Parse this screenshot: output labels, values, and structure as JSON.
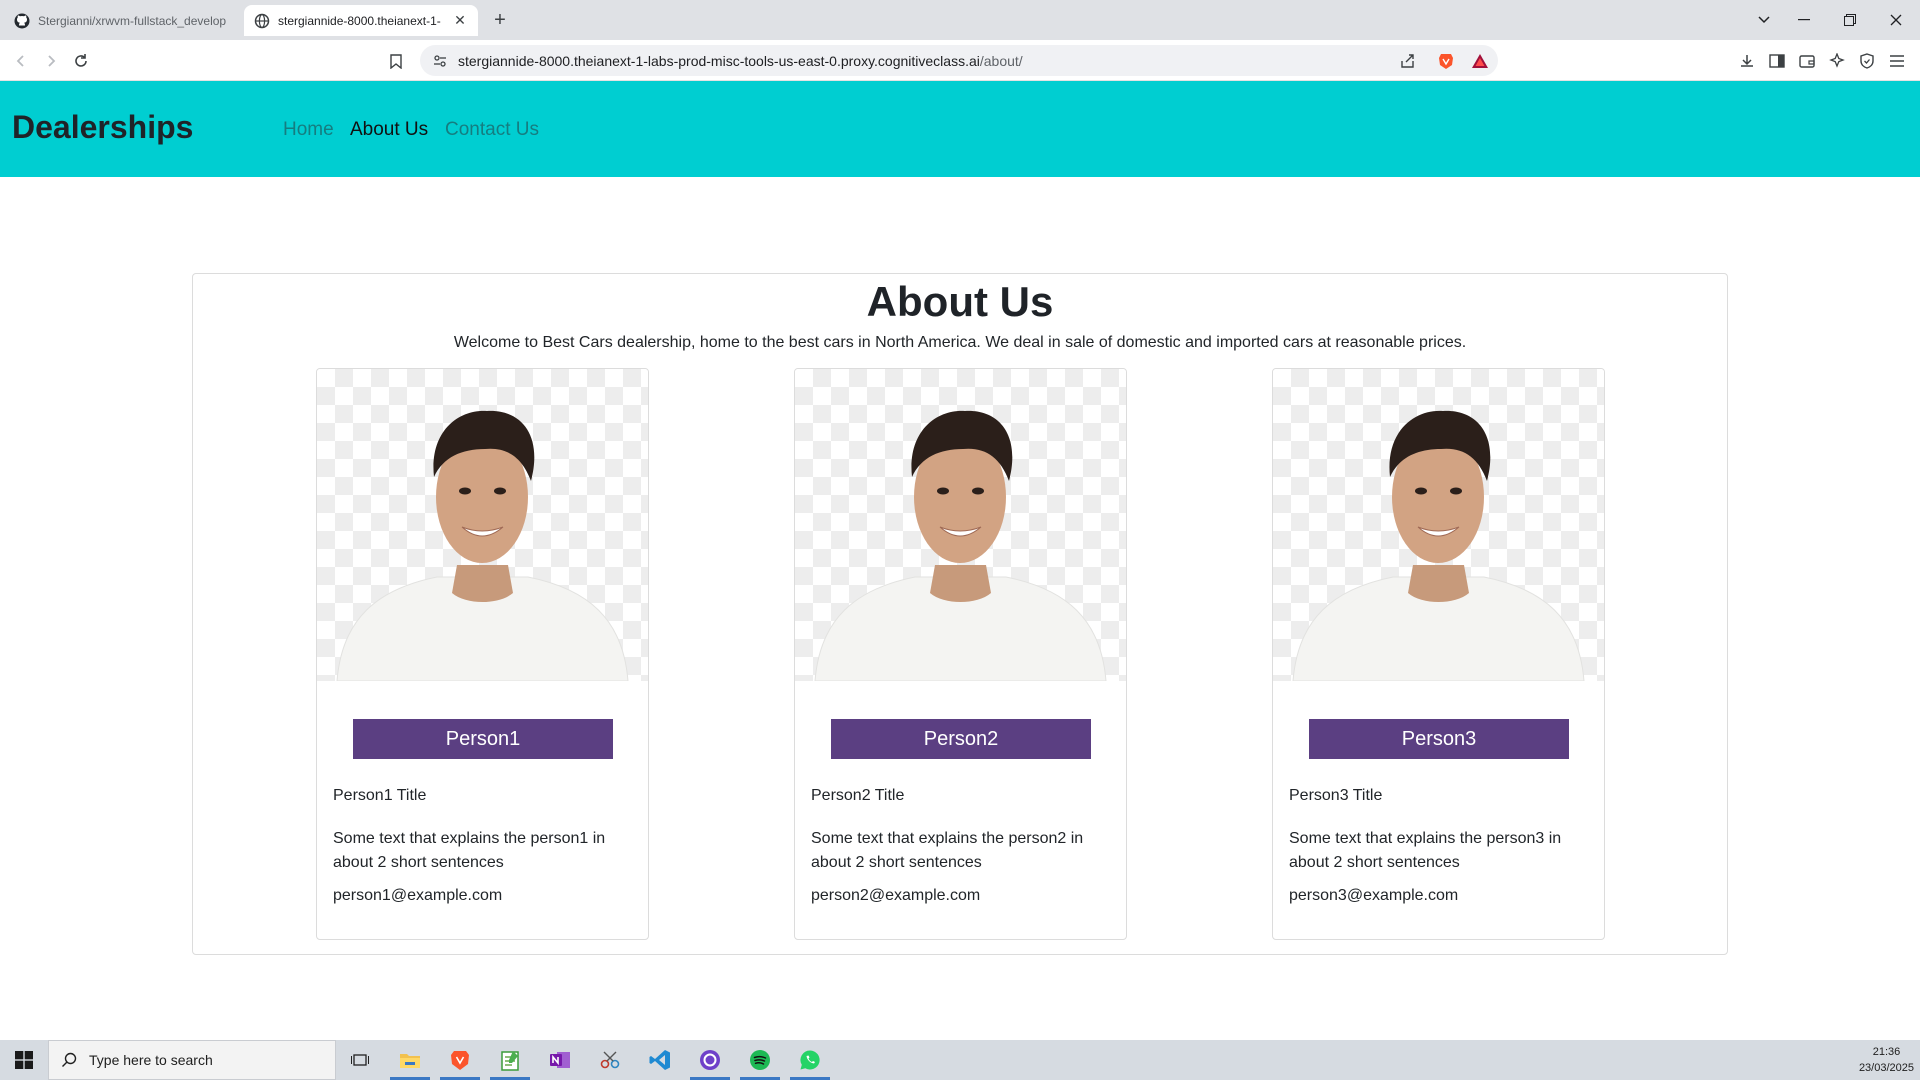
{
  "browser": {
    "tabs": [
      {
        "title": "Stergianni/xrwvm-fullstack_develop",
        "icon": "github-icon"
      },
      {
        "title": "stergiannide-8000.theianext-1-",
        "icon": "globe-icon"
      }
    ],
    "url_host": "stergiannide-8000.theianext-1-labs-prod-misc-tools-us-east-0.proxy.cognitiveclass.ai",
    "url_path": "/about/"
  },
  "navbar": {
    "brand": "Dealerships",
    "links": [
      {
        "label": "Home",
        "active": false
      },
      {
        "label": "About Us",
        "active": true
      },
      {
        "label": "Contact Us",
        "active": false
      }
    ],
    "background": "#00ced1"
  },
  "about": {
    "title": "About Us",
    "description": "Welcome to Best Cars dealership, home to the best cars in North America. We deal in sale of domestic and imported cars at reasonable prices."
  },
  "people": [
    {
      "name": "Person1",
      "title": "Person1 Title",
      "text": "Some text that explains the person1 in about 2 short sentences",
      "email": "person1@example.com"
    },
    {
      "name": "Person2",
      "title": "Person2 Title",
      "text": "Some text that explains the person2 in about 2 short sentences",
      "email": "person2@example.com"
    },
    {
      "name": "Person3",
      "title": "Person3 Title",
      "text": "Some text that explains the person3 in about 2 short sentences",
      "email": "person3@example.com"
    }
  ],
  "colors": {
    "badge": "#5b3f82"
  },
  "taskbar": {
    "search_placeholder": "Type here to search",
    "time": "21:36",
    "date": "23/03/2025",
    "apps": [
      "task-view-icon",
      "file-explorer-icon",
      "brave-icon",
      "notepad-icon",
      "onenote-icon",
      "snipping-tool-icon",
      "vscode-icon",
      "github-desktop-icon",
      "spotify-icon",
      "whatsapp-icon"
    ]
  }
}
